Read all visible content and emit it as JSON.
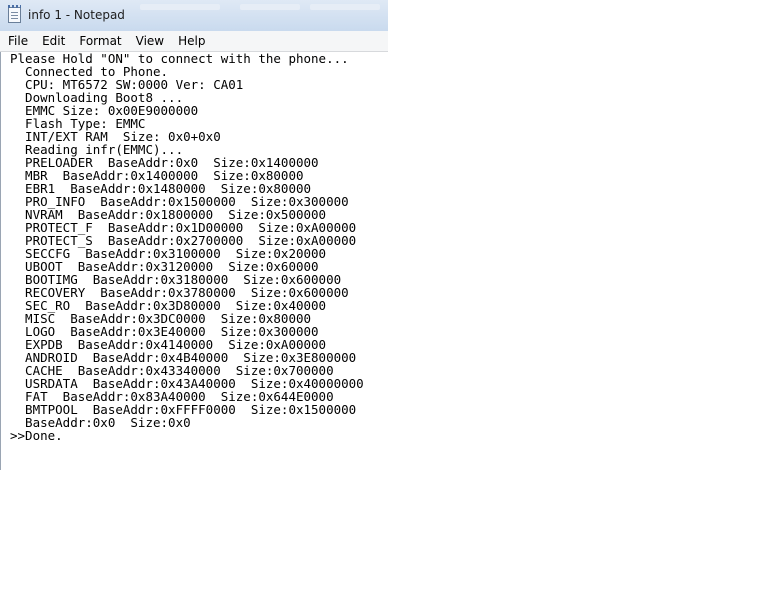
{
  "window": {
    "title": "info 1 - Notepad",
    "icon": "notepad-icon"
  },
  "menu": {
    "items": [
      "File",
      "Edit",
      "Format",
      "View",
      "Help"
    ]
  },
  "editor": {
    "lines": [
      "Please Hold \"ON\" to connect with the phone...",
      "  Connected to Phone.",
      "  CPU: MT6572 SW:0000 Ver: CA01",
      "  Downloading Boot8 ...",
      "  EMMC Size: 0x00E9000000",
      "  Flash Type: EMMC",
      "  INT/EXT RAM  Size: 0x0+0x0",
      "  Reading infr(EMMC)...",
      "  PRELOADER  BaseAddr:0x0  Size:0x1400000",
      "  MBR  BaseAddr:0x1400000  Size:0x80000",
      "  EBR1  BaseAddr:0x1480000  Size:0x80000",
      "  PRO_INFO  BaseAddr:0x1500000  Size:0x300000",
      "  NVRAM  BaseAddr:0x1800000  Size:0x500000",
      "  PROTECT_F  BaseAddr:0x1D00000  Size:0xA00000",
      "  PROTECT_S  BaseAddr:0x2700000  Size:0xA00000",
      "  SECCFG  BaseAddr:0x3100000  Size:0x20000",
      "  UBOOT  BaseAddr:0x3120000  Size:0x60000",
      "  BOOTIMG  BaseAddr:0x3180000  Size:0x600000",
      "  RECOVERY  BaseAddr:0x3780000  Size:0x600000",
      "  SEC_RO  BaseAddr:0x3D80000  Size:0x40000",
      "  MISC  BaseAddr:0x3DC0000  Size:0x80000",
      "  LOGO  BaseAddr:0x3E40000  Size:0x300000",
      "  EXPDB  BaseAddr:0x4140000  Size:0xA00000",
      "  ANDROID  BaseAddr:0x4B40000  Size:0x3E800000",
      "  CACHE  BaseAddr:0x43340000  Size:0x700000",
      "  USRDATA  BaseAddr:0x43A40000  Size:0x40000000",
      "  FAT  BaseAddr:0x83A40000  Size:0x644E0000",
      "  BMTPOOL  BaseAddr:0xFFFF0000  Size:0x1500000",
      "  BaseAddr:0x0  Size:0x0",
      ">>Done."
    ]
  }
}
